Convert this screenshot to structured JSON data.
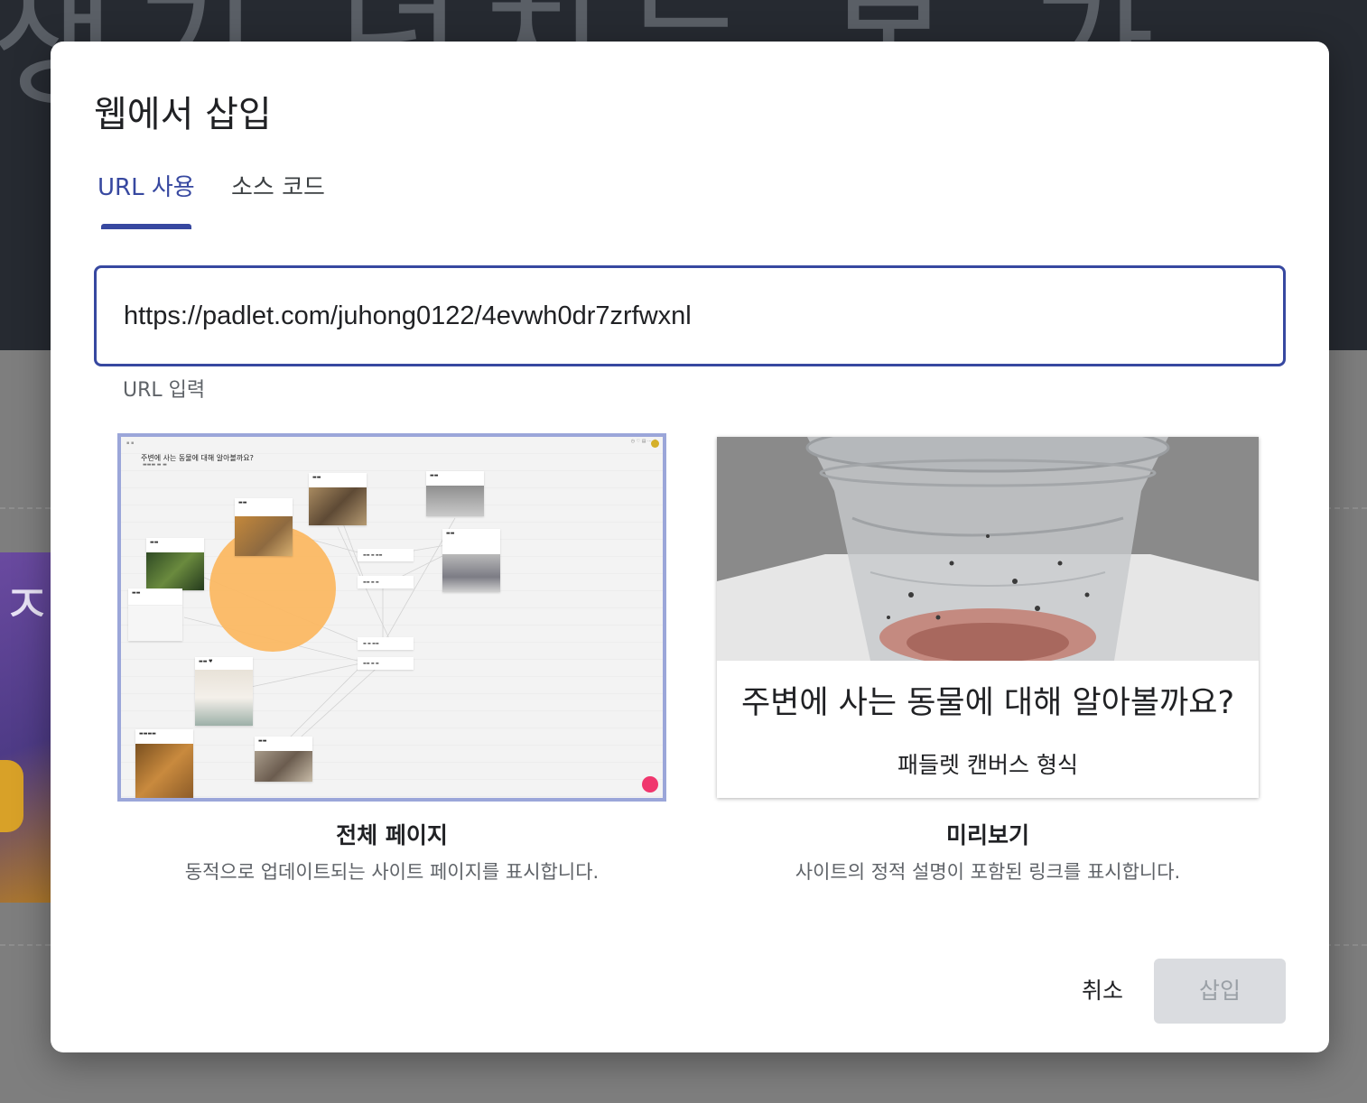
{
  "background": {
    "title_text": "생기 넘치는 봄 가"
  },
  "dialog": {
    "title": "웹에서 삽입",
    "tabs": [
      {
        "label": "URL 사용",
        "active": true
      },
      {
        "label": "소스 코드",
        "active": false
      }
    ],
    "url_field": {
      "value": "https://padlet.com/juhong0122/4evwh0dr7zrfwxnl",
      "helper": "URL 입력"
    },
    "options": [
      {
        "label": "전체 페이지",
        "description": "동적으로 업데이트되는 사이트 페이지를 표시합니다.",
        "selected": true
      },
      {
        "label": "미리보기",
        "description": "사이트의 정적 설명이 포함된 링크를 표시합니다.",
        "selected": false
      }
    ],
    "full_page_thumbnail": {
      "title": "주변에 사는 동물에 대해 알아볼까요?"
    },
    "preview_card": {
      "title": "주변에 사는 동물에 대해 알아볼까요?",
      "subtitle": "패들렛 캔버스 형식"
    },
    "buttons": {
      "cancel": "취소",
      "insert": "삽입"
    }
  },
  "colors": {
    "accent": "#3748a0",
    "selected_border": "#9ba6d9",
    "disabled_bg": "#dadce0",
    "disabled_text": "#9aa0a6",
    "pink_dot": "#f0376e",
    "orange_circle": "#fbb863"
  }
}
